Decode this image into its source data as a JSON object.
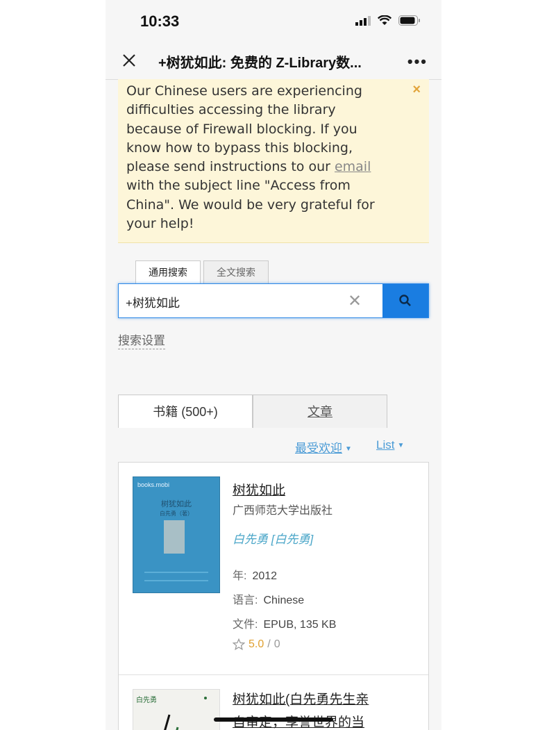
{
  "status": {
    "time": "10:33"
  },
  "navbar": {
    "title": "+树犹如此: 免费的 Z-Library数...",
    "more": "•••"
  },
  "notice": {
    "text_before": "Our Chinese users are experiencing difficulties accessing the library because of Firewall blocking. If you know how to bypass this blocking, please send instructions to our ",
    "link": "email",
    "text_after": " with the subject line \"Access from China\". We would be very grateful for your help!",
    "close": "×"
  },
  "search": {
    "tabs": [
      "通用搜索",
      "全文搜索"
    ],
    "value": "+树犹如此",
    "clear": "✕",
    "settings": "搜索设置"
  },
  "content_tabs": {
    "books": "书籍 (500+)",
    "articles": "文章"
  },
  "sort": {
    "popular": "最受欢迎",
    "view": "List"
  },
  "results": [
    {
      "title": "树犹如此",
      "publisher": "广西师范大学出版社",
      "author": "白先勇 [白先勇]",
      "year_label": "年:",
      "year": "2012",
      "lang_label": "语言:",
      "language": "Chinese",
      "file_label": "文件:",
      "file": "EPUB, 135 KB",
      "rating": "5.0",
      "rating_sep": "/",
      "rating_other": "0",
      "cover": {
        "top_text": "books.mobi",
        "title": "树犹如此",
        "sub": "白先勇（著）"
      }
    },
    {
      "title_line1": "树犹如此(白先勇先生亲",
      "title_line2": "自审定，享誉世界的当",
      "cover": {
        "title": "白先勇"
      }
    }
  ]
}
